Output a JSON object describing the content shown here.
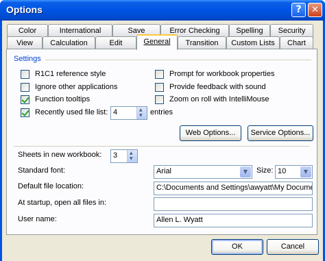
{
  "window": {
    "title": "Options",
    "help_glyph": "?",
    "close_glyph": "✕"
  },
  "tabs_row1": [
    {
      "label": "Color"
    },
    {
      "label": "International"
    },
    {
      "label": "Save"
    },
    {
      "label": "Error Checking"
    },
    {
      "label": "Spelling"
    },
    {
      "label": "Security"
    }
  ],
  "tabs_row2": [
    {
      "label": "View"
    },
    {
      "label": "Calculation"
    },
    {
      "label": "Edit"
    },
    {
      "label": "General",
      "active": true
    },
    {
      "label": "Transition"
    },
    {
      "label": "Custom Lists"
    },
    {
      "label": "Chart"
    }
  ],
  "settings": {
    "group_label": "Settings",
    "r1c1": {
      "label": "R1C1 reference style",
      "checked": false
    },
    "ignore_apps": {
      "label": "Ignore other applications",
      "checked": false
    },
    "function_tooltips": {
      "label": "Function tooltips",
      "checked": true
    },
    "recent_files": {
      "label": "Recently used file list:",
      "checked": true,
      "value": "4",
      "suffix": "entries"
    },
    "prompt_props": {
      "label": "Prompt for workbook properties",
      "checked": false
    },
    "feedback_sound": {
      "label": "Provide feedback with sound",
      "checked": false
    },
    "zoom_roll": {
      "label": "Zoom on roll with IntelliMouse",
      "checked": false
    },
    "web_options_button": "Web Options...",
    "service_options_button": "Service Options..."
  },
  "workbook": {
    "sheets_label": "Sheets in new workbook:",
    "sheets_value": "3",
    "font_label": "Standard font:",
    "font_value": "Arial",
    "size_label": "Size:",
    "size_value": "10",
    "file_location_label": "Default file location:",
    "file_location_value": "C:\\Documents and Settings\\awyatt\\My Document",
    "startup_label": "At startup, open all files in:",
    "startup_value": "",
    "user_name_label": "User name:",
    "user_name_value": "Allen L. Wyatt"
  },
  "footer": {
    "ok_label": "OK",
    "cancel_label": "Cancel"
  }
}
